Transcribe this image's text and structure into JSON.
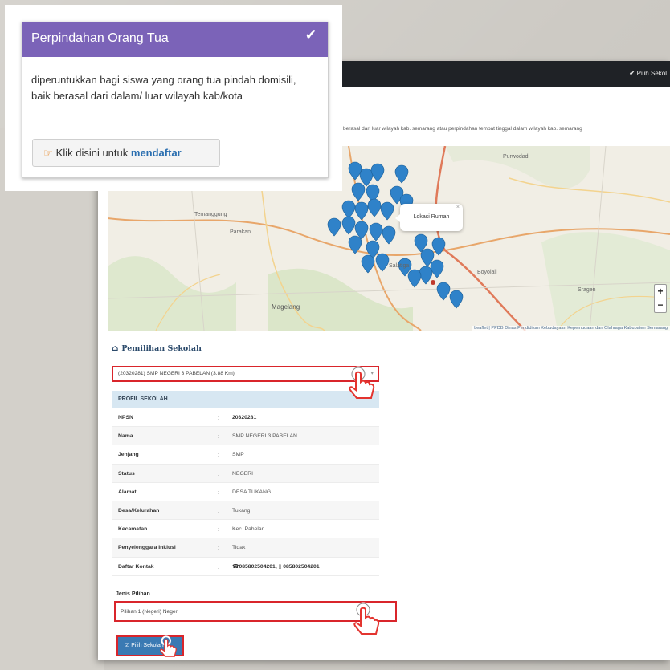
{
  "card": {
    "title": "Perpindahan Orang Tua",
    "description": "diperuntukkan bagi siswa yang orang tua pindah domisili, baik berasal dari dalam/ luar wilayah kab/kota",
    "button_prefix": "Klik disini untuk",
    "button_link": "mendaftar",
    "check_icon": "check-icon",
    "hand_icon": "hand-point-right-icon",
    "header_color": "#7b63b8"
  },
  "topbar": {
    "pilih_label": "Pilih Sekol"
  },
  "intro": {
    "text": "berasal dari luar wilayah kab. semarang atau perpindahan tempat tinggal dalam wilayah kab. semarang"
  },
  "map": {
    "popup_text": "Lokasi Rumah",
    "popup_close": "×",
    "zoom_in": "+",
    "zoom_out": "−",
    "attribution": "Leaflet | PPDB Dinas Pendidikan Kebudayaan Kepemudaan dan Olahraga Kabupaten Semarang",
    "places": [
      "Purwodadi",
      "Temanggung",
      "Parakan",
      "Salatiga",
      "Magelang",
      "Boyolali",
      "Sragen"
    ]
  },
  "section": {
    "title": "Pemilihan Sekolah",
    "icon": "home-icon"
  },
  "school_select": {
    "value": "(20320281) SMP NEGERI 3 PABELAN (3.88 Km)"
  },
  "profile": {
    "header": "PROFIL SEKOLAH",
    "rows": [
      {
        "label": "NPSN",
        "value": "20320281"
      },
      {
        "label": "Nama",
        "value": "SMP NEGERI 3 PABELAN"
      },
      {
        "label": "Jenjang",
        "value": "SMP"
      },
      {
        "label": "Status",
        "value": "NEGERI"
      },
      {
        "label": "Alamat",
        "value": "DESA TUKANG"
      },
      {
        "label": "Desa/Kelurahan",
        "value": "Tukang"
      },
      {
        "label": "Kecamatan",
        "value": "Kec. Pabelan"
      },
      {
        "label": "Penyelenggara Inklusi",
        "value": "Tidak"
      },
      {
        "label": "Daftar Kontak",
        "value": "☎085802504201, ▯ 085802504201"
      }
    ]
  },
  "jenis": {
    "label": "Jenis Pilihan",
    "value": "Pilihan 1 (Negeri) Negeri"
  },
  "pilih_button": {
    "label": "Pilih Sekolah"
  },
  "colors": {
    "highlight": "#d9252b",
    "button_blue": "#3a7ab3",
    "marker": "#2f82c9"
  }
}
